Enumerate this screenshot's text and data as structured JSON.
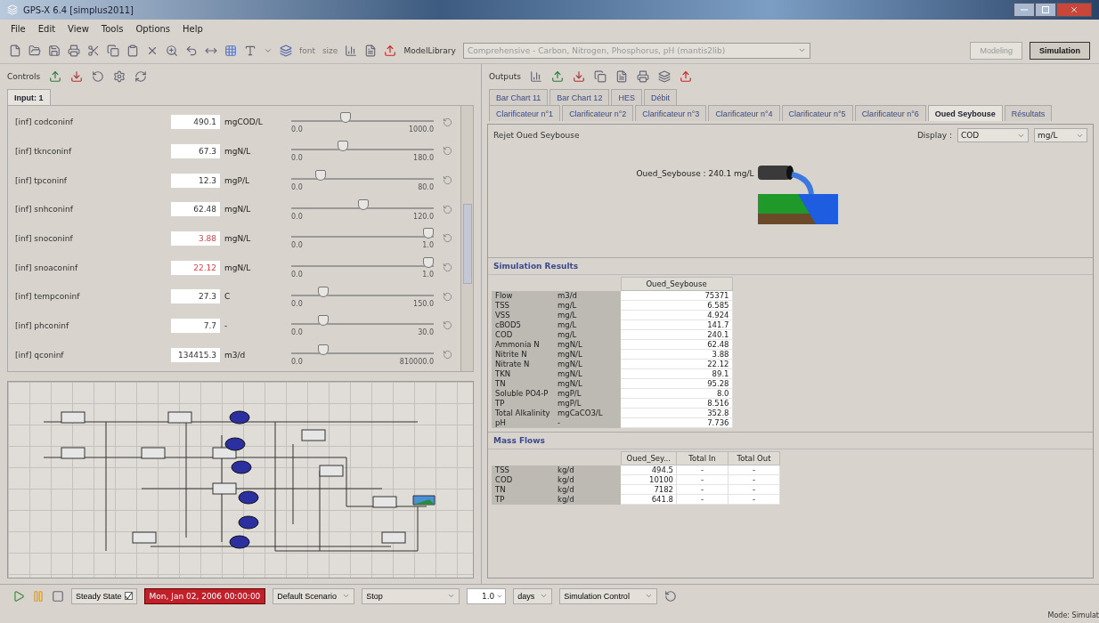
{
  "window": {
    "title": "GPS-X 6.4 [simplus2011]"
  },
  "menu": [
    "File",
    "Edit",
    "View",
    "Tools",
    "Options",
    "Help"
  ],
  "toolbar": {
    "font_label": "font",
    "size_label": "size",
    "library_label": "ModelLibrary",
    "library_value": "Comprehensive - Carbon, Nitrogen, Phosphorus, pH (mantis2lib)",
    "modes": [
      {
        "label": "Modeling",
        "selected": false
      },
      {
        "label": "Simulation",
        "selected": true
      }
    ]
  },
  "controls": {
    "title": "Controls",
    "tabs": [
      {
        "label": "Input: 1",
        "selected": true
      }
    ],
    "rows": [
      {
        "name": "[inf] codconinf",
        "value": "490.1",
        "unit": "mgCOD/L",
        "min": "0.0",
        "max": "1000.0",
        "level": 0.37,
        "warning": false
      },
      {
        "name": "[inf] tknconinf",
        "value": "67.3",
        "unit": "mgN/L",
        "min": "0.0",
        "max": "180.0",
        "level": 0.35,
        "warning": false
      },
      {
        "name": "[inf] tpconinf",
        "value": "12.3",
        "unit": "mgP/L",
        "min": "0.0",
        "max": "80.0",
        "level": 0.18,
        "warning": false
      },
      {
        "name": "[inf] snhconinf",
        "value": "62.48",
        "unit": "mgN/L",
        "min": "0.0",
        "max": "120.0",
        "level": 0.51,
        "warning": false
      },
      {
        "name": "[inf] snoconinf",
        "value": "3.88",
        "unit": "mgN/L",
        "min": "0.0",
        "max": "1.0",
        "level": 1.0,
        "warning": true
      },
      {
        "name": "[inf] snoaconinf",
        "value": "22.12",
        "unit": "mgN/L",
        "min": "0.0",
        "max": "1.0",
        "level": 1.0,
        "warning": true
      },
      {
        "name": "[inf] tempconinf",
        "value": "27.3",
        "unit": "C",
        "min": "0.0",
        "max": "150.0",
        "level": 0.2,
        "warning": false
      },
      {
        "name": "[inf] phconinf",
        "value": "7.7",
        "unit": "-",
        "min": "0.0",
        "max": "30.0",
        "level": 0.2,
        "warning": false
      },
      {
        "name": "[inf] qconinf",
        "value": "134415.3",
        "unit": "m3/d",
        "min": "0.0",
        "max": "810000.0",
        "level": 0.2,
        "warning": false
      }
    ]
  },
  "outputs": {
    "title": "Outputs",
    "tabs_top": [
      {
        "label": "Bar Chart 11",
        "selected": false
      },
      {
        "label": "Bar Chart 12",
        "selected": false
      },
      {
        "label": "HES",
        "selected": false
      },
      {
        "label": "Débit",
        "selected": false
      }
    ],
    "tabs": [
      {
        "label": "Clarificateur n°1",
        "selected": false
      },
      {
        "label": "Clarificateur n°2",
        "selected": false
      },
      {
        "label": "Clarificateur n°3",
        "selected": false
      },
      {
        "label": "Clarificateur n°4",
        "selected": false
      },
      {
        "label": "Clarificateur n°5",
        "selected": false
      },
      {
        "label": "Clarificateur n°6",
        "selected": false
      },
      {
        "label": "Oued Seybouse",
        "selected": true
      },
      {
        "label": "Résultats",
        "selected": false
      }
    ],
    "panel_title": "Rejet Oued Seybouse",
    "display_label": "Display :",
    "display_variable": "COD",
    "display_unit": "mg/L",
    "outfall_label": "Oued_Seybouse : 240.1 mg/L",
    "results": {
      "title": "Simulation Results",
      "column": "Oued_Seybouse",
      "rows": [
        {
          "name": "Flow",
          "unit": "m3/d",
          "value": "75371"
        },
        {
          "name": "TSS",
          "unit": "mg/L",
          "value": "6.585"
        },
        {
          "name": "VSS",
          "unit": "mg/L",
          "value": "4.924"
        },
        {
          "name": "cBOD5",
          "unit": "mg/L",
          "value": "141.7"
        },
        {
          "name": "COD",
          "unit": "mg/L",
          "value": "240.1"
        },
        {
          "name": "Ammonia N",
          "unit": "mgN/L",
          "value": "62.48"
        },
        {
          "name": "Nitrite N",
          "unit": "mgN/L",
          "value": "3.88"
        },
        {
          "name": "Nitrate N",
          "unit": "mgN/L",
          "value": "22.12"
        },
        {
          "name": "TKN",
          "unit": "mgN/L",
          "value": "89.1"
        },
        {
          "name": "TN",
          "unit": "mgN/L",
          "value": "95.28"
        },
        {
          "name": "Soluble PO4-P",
          "unit": "mgP/L",
          "value": "8.0"
        },
        {
          "name": "TP",
          "unit": "mgP/L",
          "value": "8.516"
        },
        {
          "name": "Total Alkalinity",
          "unit": "mgCaCO3/L",
          "value": "352.8"
        },
        {
          "name": "pH",
          "unit": "-",
          "value": "7.736"
        }
      ]
    },
    "mass_flows": {
      "title": "Mass Flows",
      "columns": [
        "Oued_Sey...",
        "Total In",
        "Total Out"
      ],
      "rows": [
        {
          "name": "TSS",
          "unit": "kg/d",
          "values": [
            "494.5",
            "-",
            "-"
          ]
        },
        {
          "name": "COD",
          "unit": "kg/d",
          "values": [
            "10100",
            "-",
            "-"
          ]
        },
        {
          "name": "TN",
          "unit": "kg/d",
          "values": [
            "7182",
            "-",
            "-"
          ]
        },
        {
          "name": "TP",
          "unit": "kg/d",
          "values": [
            "641.8",
            "-",
            "-"
          ]
        }
      ]
    }
  },
  "run_bar": {
    "steady_state_label": "Steady State",
    "steady_state": true,
    "time": "Mon, Jan 02, 2006 00:00:00",
    "scenario": "Default Scenario",
    "stop": "Stop",
    "interval": "1.0",
    "interval_unit": "days",
    "control": "Simulation Control"
  },
  "status_bar": {
    "mode": "Mode: Simulat"
  }
}
